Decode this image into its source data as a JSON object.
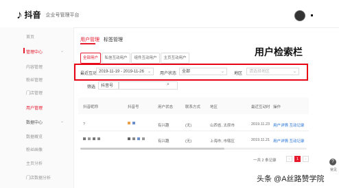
{
  "header": {
    "logo_glyph": "♪",
    "logo_text": "抖音",
    "subtitle": "企业号管理平台"
  },
  "sidebar": {
    "items": [
      {
        "label": "首页"
      },
      {
        "label": "管理中心",
        "group": true
      },
      {
        "label": "内容管理"
      },
      {
        "label": "粉丝管理"
      },
      {
        "label": "门店管理"
      },
      {
        "label": "用户管理",
        "active": true
      },
      {
        "label": "数据中心",
        "group": true
      },
      {
        "label": "数据概览"
      },
      {
        "label": "粉丝画像"
      },
      {
        "label": "主页分析"
      },
      {
        "label": "门店数据分析"
      }
    ]
  },
  "main_tabs": [
    {
      "label": "用户管理",
      "active": true
    },
    {
      "label": "标签管理"
    }
  ],
  "sub_tabs": [
    {
      "label": "全部用户",
      "active": true
    },
    {
      "label": "私信互动用户"
    },
    {
      "label": "组件互动用户"
    },
    {
      "label": "主页互动用户"
    }
  ],
  "annotation": "用户检索栏",
  "filters": {
    "recent_label": "最近互动",
    "date_range": "2019-11-19 - 2019-11-26",
    "status_label": "用户状态",
    "status_value": "全部",
    "region_label": "地区",
    "region_placeholder": "请选择地区",
    "filter_label": "筛选",
    "filter_field": "抖音号",
    "search_icon": "⌕"
  },
  "table": {
    "columns": [
      "抖音昵称",
      "抖音号",
      "用户状态",
      "联系方式",
      "地区",
      "最近互动时",
      "操作"
    ],
    "rows": [
      {
        "nickname": "?",
        "status": "有兴趣",
        "contact": "(无)",
        "region": "山西省, 太原市",
        "time": "2019.11.23",
        "ops": "用户详情  互动记录"
      },
      {
        "nickname": "",
        "status": "有兴趣",
        "contact": "(无)",
        "region": "上海市, 市辖区",
        "time": "2019.11.21",
        "ops": "用户详情  互动记录"
      }
    ]
  },
  "pagination": {
    "total": "一共 2 条记录",
    "prev": "‹",
    "page": "1",
    "next": "›"
  },
  "help": {
    "icon": "?",
    "label": "常见"
  },
  "watermark": "头条 @A丝路赞学院",
  "colors": {
    "accent": "#e6192d",
    "highlight_box": "#e60012",
    "link": "#1f6fd6"
  }
}
